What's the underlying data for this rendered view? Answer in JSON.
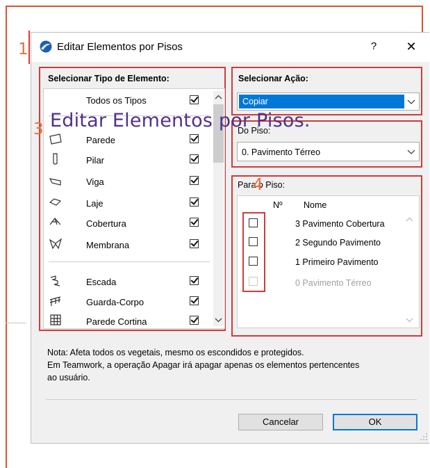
{
  "annotations": {
    "n1": "1",
    "n3": "3",
    "n4": "4"
  },
  "overlay_title": "Editar Elementos por Pisos.",
  "dialog": {
    "title": "Editar Elementos por Pisos",
    "help": "?",
    "close": "✕"
  },
  "element_type": {
    "group_title": "Selecionar Tipo de Elemento:",
    "all_types": {
      "label": "Todos os Tipos",
      "checked": true
    },
    "items": [
      {
        "icon": "wall-icon",
        "label": "Parede",
        "checked": true
      },
      {
        "icon": "column-icon",
        "label": "Pilar",
        "checked": true
      },
      {
        "icon": "beam-icon",
        "label": "Viga",
        "checked": true
      },
      {
        "icon": "slab-icon",
        "label": "Laje",
        "checked": true
      },
      {
        "icon": "roof-icon",
        "label": "Cobertura",
        "checked": true
      },
      {
        "icon": "membrane-icon",
        "label": "Membrana",
        "checked": true
      },
      {
        "icon": "stair-icon",
        "label": "Escada",
        "checked": true
      },
      {
        "icon": "railing-icon",
        "label": "Guarda-Corpo",
        "checked": true
      },
      {
        "icon": "curtain-wall-icon",
        "label": "Parede Cortina",
        "checked": true
      }
    ]
  },
  "action": {
    "group_title": "Selecionar Ação:",
    "selected": "Copiar"
  },
  "from_story": {
    "group_title": "Do Piso:",
    "selected": "0. Pavimento Térreo"
  },
  "to_story": {
    "group_title": "Para o Piso:",
    "col_no": "Nº",
    "col_name": "Nome",
    "rows": [
      {
        "name": "3 Pavimento Cobertura",
        "checked": false,
        "enabled": true
      },
      {
        "name": "2 Segundo Pavimento",
        "checked": false,
        "enabled": true
      },
      {
        "name": "1 Primeiro Pavimento",
        "checked": false,
        "enabled": true
      },
      {
        "name": "0 Pavimento Térreo",
        "checked": false,
        "enabled": false
      }
    ]
  },
  "note": {
    "line1": "Nota: Afeta todos os vegetais, mesmo os escondidos e protegidos.",
    "line2": "Em Teamwork, a operação Apagar irá apagar apenas os elementos pertencentes",
    "line3": "ao usuário."
  },
  "buttons": {
    "cancel": "Cancelar",
    "ok": "OK"
  },
  "colors": {
    "annotation_box": "#d23a3a",
    "annotation_number": "#e2703a",
    "selection": "#0078d7",
    "overlay_title": "#52318a"
  }
}
